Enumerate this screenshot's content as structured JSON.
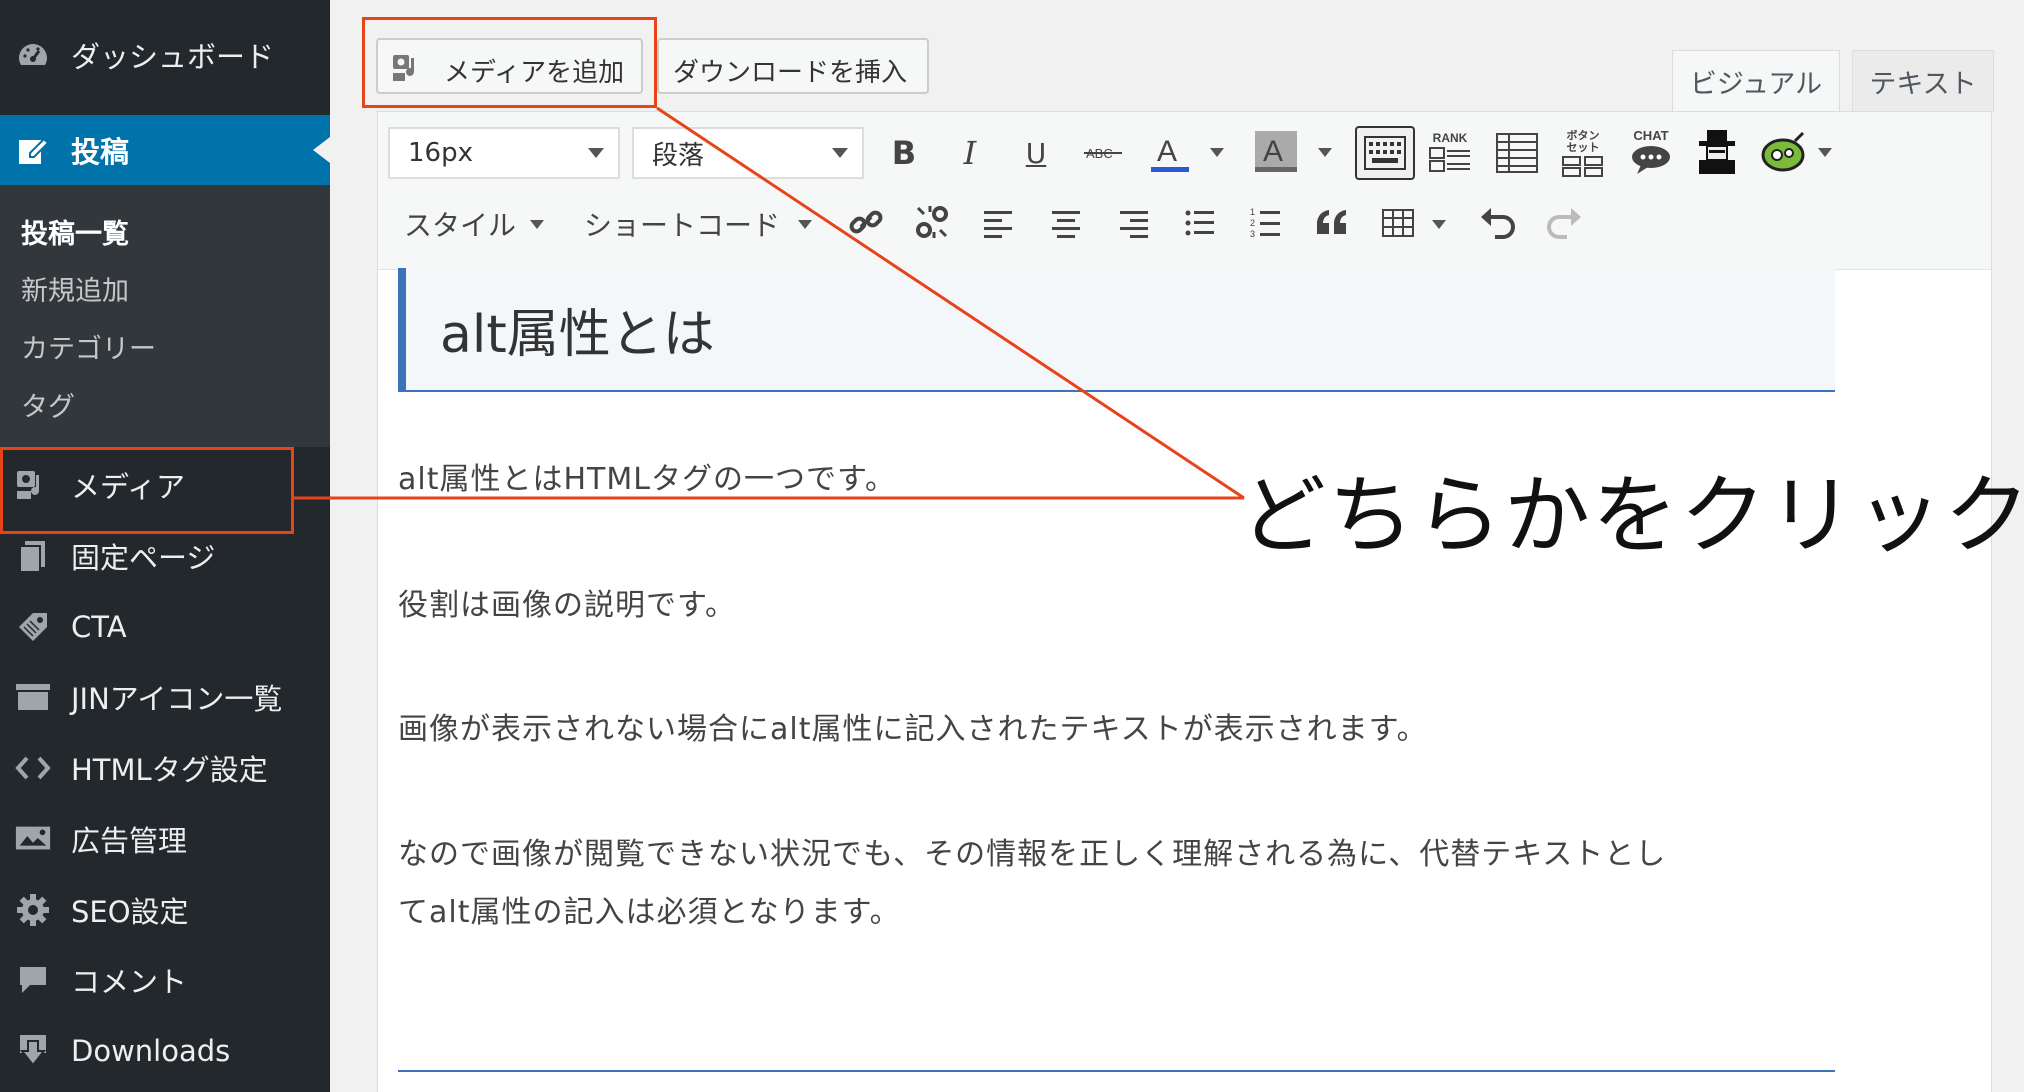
{
  "sidebar": {
    "dashboard": "ダッシュボード",
    "posts": "投稿",
    "submenu": [
      "投稿一覧",
      "新規追加",
      "カテゴリー",
      "タグ"
    ],
    "media": "メディア",
    "pages": "固定ページ",
    "cta": "CTA",
    "jin_icons": "JINアイコン一覧",
    "html_tags": "HTMLタグ設定",
    "ads": "広告管理",
    "seo": "SEO設定",
    "comments": "コメント",
    "downloads": "Downloads"
  },
  "editor": {
    "add_media_label": "メディアを追加",
    "insert_download_label": "ダウンロードを挿入",
    "tab_visual": "ビジュアル",
    "tab_text": "テキスト",
    "font_size": "16px",
    "format": "段落",
    "style_dropdown": "スタイル",
    "shortcode_dropdown": "ショートコード",
    "icon_labels": {
      "rank": "RANK",
      "button": "ボタン",
      "set": "セット",
      "chat": "CHAT"
    }
  },
  "content": {
    "heading": "alt属性とは",
    "paragraphs": [
      "alt属性とはHTMLタグの一つです。",
      "役割は画像の説明です。",
      "画像が表示されない場合にalt属性に記入されたテキストが表示されます。",
      "なので画像が閲覧できない状況でも、その情報を正しく理解される為に、代替テキストとし",
      "てalt属性の記入は必須となります。"
    ]
  },
  "annotation": {
    "text": "どちらかをクリック",
    "color": "#e8441a"
  },
  "colors": {
    "sidebar_bg": "#23282d",
    "active": "#0073aa",
    "heading_accent": "#3b73b9"
  }
}
